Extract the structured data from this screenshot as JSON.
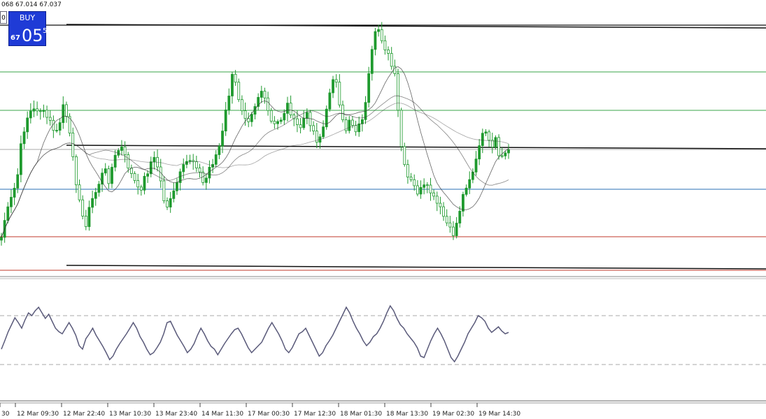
{
  "header": {
    "ohlc_text": "068 67.014 67.037"
  },
  "trade_panel": {
    "lot_text": "0",
    "buy_label": "BUY",
    "price_small": "67",
    "price_big": "05",
    "price_sup": "5"
  },
  "colors": {
    "candle": "#1f9a2e",
    "ma": "#333333",
    "rsi_line": "#5a5a7a",
    "level_green": "#3aa64a",
    "level_blue": "#2a6fb4",
    "level_red": "#c0392b",
    "level_grey": "#aaaaaa",
    "trend_black": "#111111"
  },
  "chart_data": {
    "type": "candlestick",
    "title": "",
    "xlabel": "",
    "ylabel": "",
    "x_ticks": [
      "30",
      "12 Mar 09:30",
      "12 Mar 22:40",
      "13 Mar 10:30",
      "13 Mar 23:40",
      "14 Mar 11:30",
      "17 Mar 00:30",
      "17 Mar 12:30",
      "18 Mar 01:30",
      "18 Mar 13:30",
      "19 Mar 02:30",
      "19 Mar 14:30"
    ],
    "price_series": [
      340,
      315,
      300,
      285,
      270,
      250,
      210,
      185,
      168,
      160,
      158,
      156,
      158,
      162,
      168,
      175,
      185,
      190,
      175,
      150,
      170,
      195,
      220,
      260,
      290,
      310,
      320,
      300,
      285,
      275,
      262,
      250,
      245,
      258,
      240,
      225,
      215,
      212,
      225,
      238,
      250,
      260,
      272,
      268,
      255,
      245,
      232,
      228,
      238,
      260,
      285,
      295,
      288,
      276,
      262,
      250,
      240,
      232,
      228,
      230,
      236,
      248,
      262,
      255,
      240,
      232,
      222,
      210,
      190,
      160,
      135,
      110,
      120,
      140,
      155,
      165,
      170,
      160,
      150,
      138,
      130,
      145,
      160,
      175,
      180,
      175,
      170,
      160,
      150,
      160,
      175,
      180,
      182,
      170,
      165,
      175,
      188,
      200,
      195,
      182,
      160,
      130,
      110,
      120,
      155,
      175,
      185,
      170,
      178,
      185,
      180,
      168,
      150,
      110,
      75,
      50,
      42,
      55,
      68,
      80,
      95,
      110,
      160,
      210,
      240,
      255,
      260,
      268,
      275,
      272,
      268,
      270,
      275,
      285,
      292,
      300,
      310,
      320,
      330,
      335,
      320,
      300,
      280,
      265,
      255,
      245,
      230,
      210,
      195,
      185,
      205,
      215,
      200,
      225,
      228,
      218,
      215
    ],
    "candle_count": 157,
    "horizontal_levels": [
      {
        "price": 36,
        "kind": "trend_black"
      },
      {
        "price": 103,
        "kind": "level_green"
      },
      {
        "price": 158,
        "kind": "level_green"
      },
      {
        "price": 214,
        "kind": "level_grey"
      },
      {
        "price": 271,
        "kind": "level_blue"
      },
      {
        "price": 339,
        "kind": "level_red"
      },
      {
        "price": 387,
        "kind": "level_red"
      }
    ],
    "trend_lines": [
      {
        "x1": 95,
        "y1": 35,
        "x2": 1095,
        "y2": 40
      },
      {
        "x1": 95,
        "y1": 208,
        "x2": 1095,
        "y2": 213
      },
      {
        "x1": 95,
        "y1": 380,
        "x2": 1095,
        "y2": 385
      }
    ],
    "rsi_series": [
      500,
      488,
      475,
      465,
      455,
      462,
      470,
      458,
      448,
      452,
      445,
      440,
      448,
      456,
      450,
      460,
      470,
      475,
      478,
      470,
      462,
      470,
      480,
      495,
      500,
      485,
      478,
      470,
      480,
      488,
      496,
      505,
      515,
      510,
      500,
      492,
      485,
      478,
      470,
      462,
      470,
      482,
      490,
      500,
      508,
      505,
      498,
      490,
      478,
      462,
      460,
      470,
      480,
      488,
      496,
      505,
      500,
      492,
      480,
      470,
      478,
      488,
      496,
      500,
      508,
      500,
      492,
      485,
      478,
      472,
      470,
      478,
      488,
      498,
      505,
      500,
      495,
      490,
      480,
      470,
      462,
      470,
      478,
      488,
      500,
      505,
      498,
      488,
      478,
      475,
      470,
      480,
      490,
      500,
      510,
      505,
      495,
      488,
      480,
      470,
      460,
      450,
      440,
      448,
      460,
      470,
      478,
      488,
      495,
      490,
      482,
      478,
      470,
      460,
      448,
      438,
      445,
      456,
      465,
      470,
      478,
      484,
      490,
      498,
      510,
      512,
      500,
      488,
      478,
      470,
      478,
      488,
      500,
      512,
      518,
      510,
      500,
      490,
      478,
      470,
      462,
      452,
      455,
      460,
      470,
      476,
      472,
      468,
      474,
      478,
      476
    ],
    "rsi_levels": {
      "upper": 452,
      "lower": 522
    }
  }
}
